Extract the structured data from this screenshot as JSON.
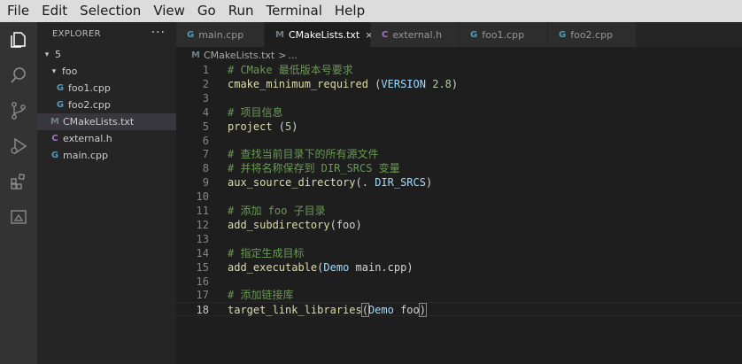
{
  "menu": [
    "File",
    "Edit",
    "Selection",
    "View",
    "Go",
    "Run",
    "Terminal",
    "Help"
  ],
  "activity_bar": [
    "explorer-icon",
    "search-icon",
    "source-control-icon",
    "run-debug-icon",
    "extensions-icon",
    "remote-explorer-icon"
  ],
  "sidebar": {
    "title": "EXPLORER",
    "more": "···",
    "tree": [
      {
        "label": "5",
        "type": "folder",
        "expanded": true,
        "indent": 0
      },
      {
        "label": "foo",
        "type": "folder",
        "expanded": true,
        "indent": 1
      },
      {
        "label": "foo1.cpp",
        "type": "cpp",
        "indent": 2
      },
      {
        "label": "foo2.cpp",
        "type": "cpp",
        "indent": 2
      },
      {
        "label": "CMakeLists.txt",
        "type": "cmake",
        "indent": 1,
        "selected": true
      },
      {
        "label": "external.h",
        "type": "header",
        "indent": 1
      },
      {
        "label": "main.cpp",
        "type": "cpp",
        "indent": 1
      }
    ]
  },
  "tabs": [
    {
      "label": "main.cpp",
      "icon": "G",
      "icon_color": "#519aba",
      "active": false
    },
    {
      "label": "CMakeLists.txt",
      "icon": "M",
      "icon_color": "#6d8086",
      "active": true,
      "close": "×"
    },
    {
      "label": "external.h",
      "icon": "C",
      "icon_color": "#a074c4",
      "active": false
    },
    {
      "label": "foo1.cpp",
      "icon": "G",
      "icon_color": "#519aba",
      "active": false
    },
    {
      "label": "foo2.cpp",
      "icon": "G",
      "icon_color": "#519aba",
      "active": false
    }
  ],
  "breadcrumb": {
    "icon": "M",
    "file": "CMakeLists.txt",
    "sep": ">",
    "rest": "..."
  },
  "code": {
    "current_line": 18,
    "lines": [
      [
        [
          "c",
          "# CMake 最低版本号要求"
        ]
      ],
      [
        [
          "f",
          "cmake_minimum_required"
        ],
        [
          "p",
          " ("
        ],
        [
          "v",
          "VERSION"
        ],
        [
          "p",
          " "
        ],
        [
          "n",
          "2.8"
        ],
        [
          "p",
          ")"
        ]
      ],
      [],
      [
        [
          "c",
          "# 项目信息"
        ]
      ],
      [
        [
          "f",
          "project"
        ],
        [
          "p",
          " ("
        ],
        [
          "n",
          "5"
        ],
        [
          "p",
          ")"
        ]
      ],
      [],
      [
        [
          "c",
          "# 查找当前目录下的所有源文件"
        ]
      ],
      [
        [
          "c",
          "# 并将名称保存到 DIR_SRCS 变量"
        ]
      ],
      [
        [
          "f",
          "aux_source_directory"
        ],
        [
          "p",
          "(. "
        ],
        [
          "v",
          "DIR_SRCS"
        ],
        [
          "p",
          ")"
        ]
      ],
      [],
      [
        [
          "c",
          "# 添加 foo 子目录"
        ]
      ],
      [
        [
          "f",
          "add_subdirectory"
        ],
        [
          "p",
          "(foo)"
        ]
      ],
      [],
      [
        [
          "c",
          "# 指定生成目标"
        ]
      ],
      [
        [
          "f",
          "add_executable"
        ],
        [
          "p",
          "("
        ],
        [
          "v",
          "Demo"
        ],
        [
          "p",
          " main.cpp)"
        ]
      ],
      [],
      [
        [
          "c",
          "# 添加链接库"
        ]
      ],
      [
        [
          "f",
          "target_link_libraries"
        ],
        [
          "p",
          "("
        ],
        [
          "v",
          "Demo"
        ],
        [
          "p",
          " foo"
        ],
        [
          "p",
          ")"
        ]
      ]
    ]
  },
  "colors": {
    "menubar_bg": "#dcdcdc",
    "activity_bg": "#333333",
    "sidebar_bg": "#252526",
    "editor_bg": "#1e1e1e",
    "comment": "#6a9955",
    "function": "#dcdcaa",
    "variable": "#9cdcfe",
    "number": "#b5cea8"
  }
}
